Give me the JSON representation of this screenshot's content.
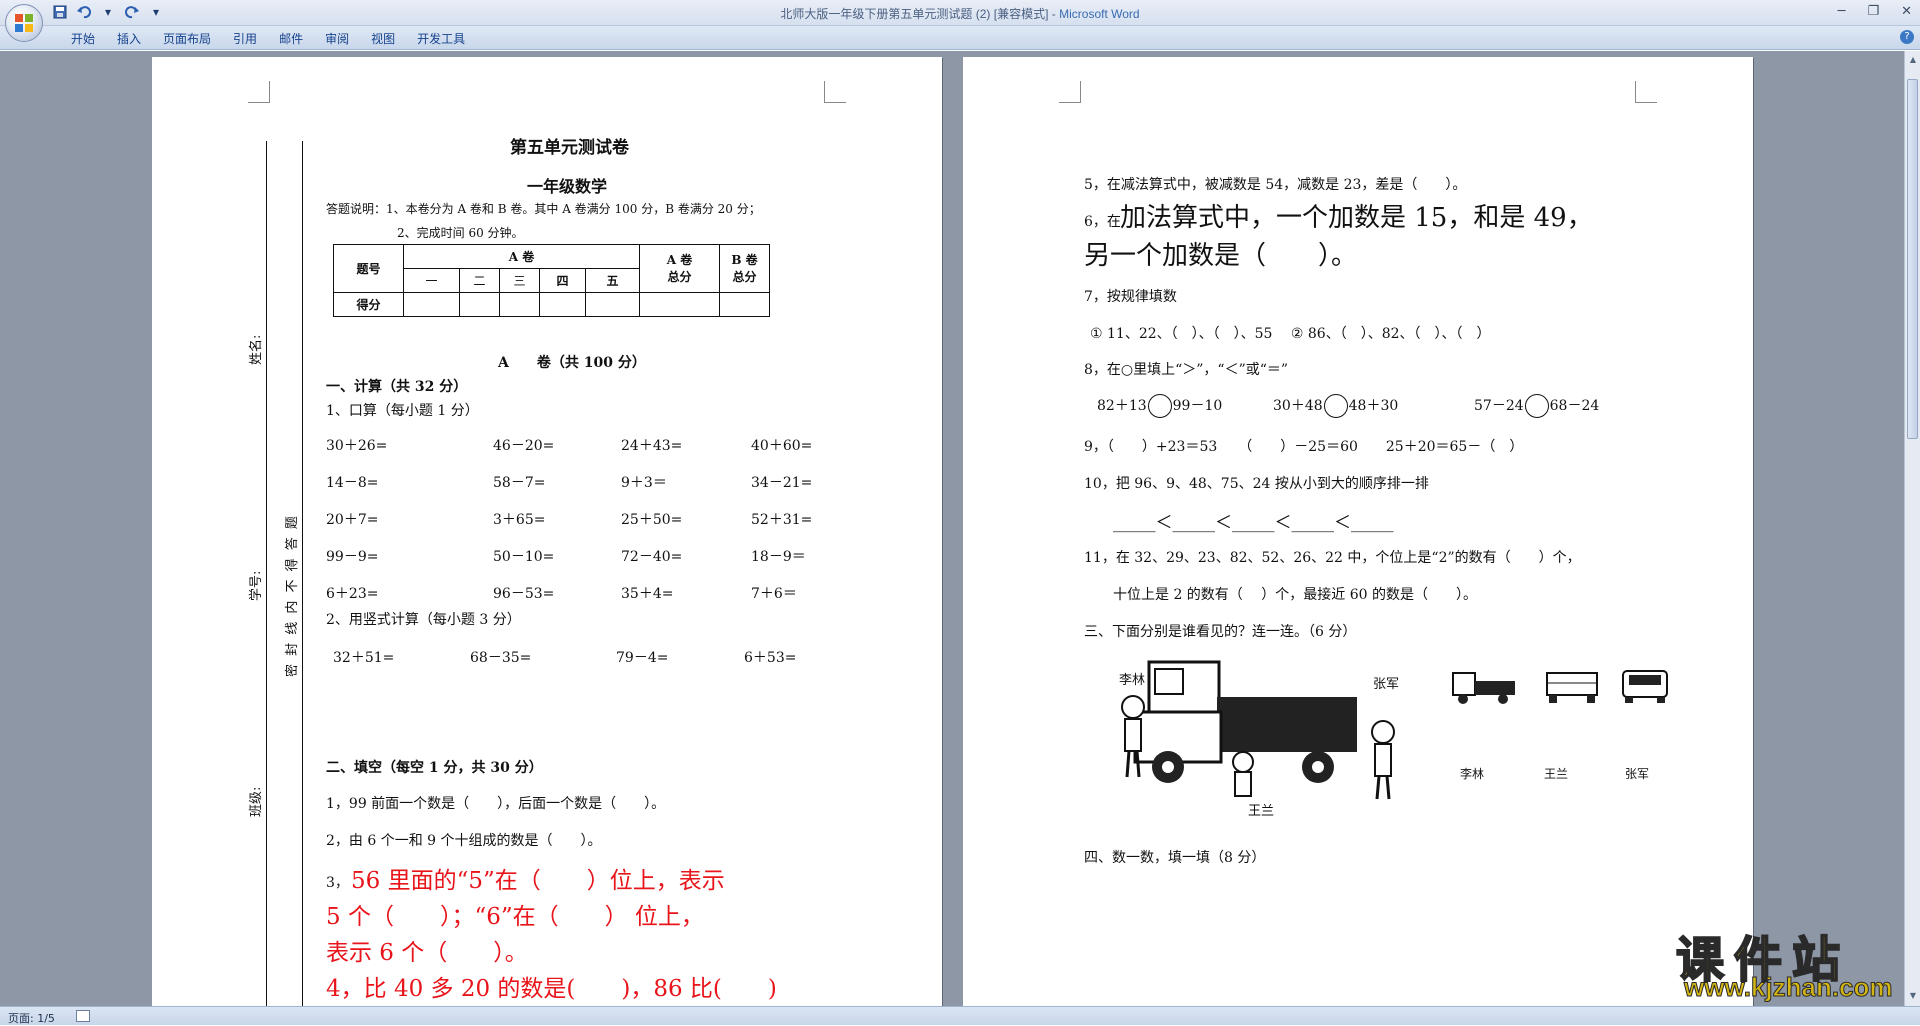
{
  "window": {
    "title_doc": "北师大版一年级下册第五单元测试题 (2) [兼容模式]",
    "title_sep": " - ",
    "title_app": "Microsoft Word"
  },
  "ribbon": {
    "tabs": [
      "开始",
      "插入",
      "页面布局",
      "引用",
      "邮件",
      "审阅",
      "视图",
      "开发工具"
    ]
  },
  "status": {
    "page": "页面: 1/5"
  },
  "page1": {
    "title": "第五单元测试卷",
    "subtitle": "一年级数学",
    "instr1": "答题说明：1、本卷分为 A 卷和 B 卷。其中 A 卷满分 100 分，B 卷满分 20 分；",
    "instr2": "2、完成时间 60 分钟。",
    "table": {
      "tihao": "题号",
      "ajuan": "A 卷",
      "cols": [
        "一",
        "二",
        "三",
        "四",
        "五"
      ],
      "azong": "A 卷\n总分",
      "bzong": "B 卷\n总分",
      "defen": "得分"
    },
    "section_a": "A　　卷（共 100 分）",
    "sec1": "一、计算（共 32 分）",
    "sub1": "1、口算（每小题 1 分）",
    "oral": [
      [
        "30＋26=",
        "46－20=",
        "24＋43=",
        "40＋60="
      ],
      [
        "14－8=",
        "58－7=",
        "9＋3＝",
        "34－21="
      ],
      [
        "20＋7=",
        "3＋65=",
        "25＋50=",
        "52＋31="
      ],
      [
        "99－9=",
        "50－10=",
        "72－40=",
        "18－9＝"
      ],
      [
        "6＋23=",
        "96－53=",
        "35＋4=",
        "7＋6＝"
      ]
    ],
    "sub2": "2、用竖式计算（每小题 3 分）",
    "vertical": [
      "32＋51=",
      "68－35=",
      "79－4=",
      "6＋53="
    ],
    "sec2": "二、填空（每空 1 分，共 30 分）",
    "q1": "1，99 前面一个数是（　　），后面一个数是（　　）。",
    "q2": "2，由 6 个一和 9 个十组成的数是（　　）。",
    "q3_no": "3，",
    "q3_l1": "56 里面的“5”在（　　）位上，表示",
    "q3_l2": "5 个（　　）；“6”在（　　） 位上，",
    "q3_l3": "表示 6 个（　　）。",
    "q4": "4，比 40 多 20 的数是(　　)，86 比(　　)",
    "side_name": "姓名:",
    "side_no": "学号:",
    "side_class": "班级:",
    "side_seal": "密 封 线 内 不 得 答 题"
  },
  "page2": {
    "q5": "5，在减法算式中，被减数是 54，减数是 23，差是（　　）。",
    "q6_no": "6，在",
    "q6_l1": "加法算式中，一个加数是 15，和是 49，",
    "q6_l2": "另一个加数是（　　）。",
    "q7": "7，按规律填数",
    "q7_seq": "① 11、22、（　）、（　）、55　 ② 86、（　）、82、（　）、（　）",
    "q8": "8，在○里填上“＞”，“＜”或“＝”",
    "q8_items": [
      {
        "l": "82＋13",
        "r": "99－10"
      },
      {
        "l": "30＋48",
        "r": "48＋30"
      },
      {
        "l": "57－24",
        "r": "68－24"
      }
    ],
    "q9": "9，（　　）+23＝53　　（　　）－25＝60　　25＋20＝65－（　）",
    "q10": "10，把 96、9、48、75、24 按从小到大的顺序排一排",
    "q10_line": "_____＜_____＜_____＜_____＜_____",
    "q11_l1": "11，在 32、29、23、82、52、26、22 中，个位上是“2”的数有（　　）个，",
    "q11_l2": "十位上是 2 的数有（　 ）个，最接近 60 的数是（　　）。",
    "sec3": "三、下面分别是谁看见的？连一连。（6 分）",
    "names_top": [
      "李林",
      "张军"
    ],
    "name_bottom": "王兰",
    "labels": [
      "李林",
      "王兰",
      "张军"
    ],
    "sec4": "四、数一数，填一填（8 分）"
  },
  "watermark": {
    "logo": "课件站",
    "url": "www.kjzhan.com"
  }
}
